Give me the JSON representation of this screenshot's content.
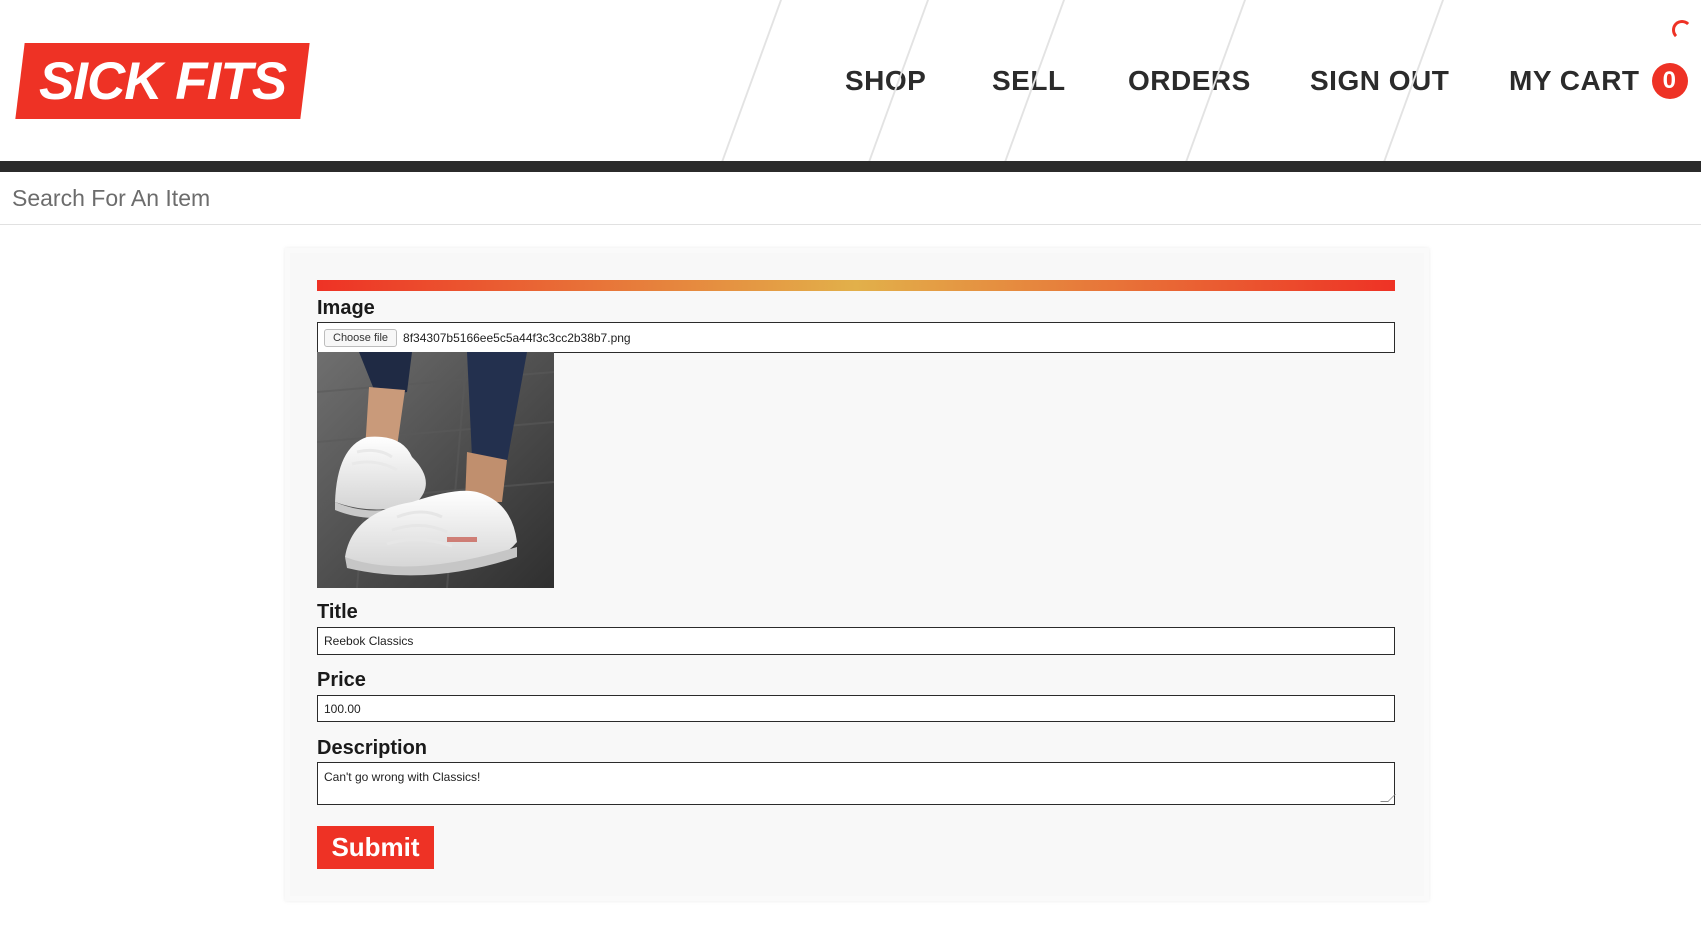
{
  "header": {
    "logo": "SICK FITS",
    "nav": {
      "shop": "SHOP",
      "sell": "SELL",
      "orders": "ORDERS",
      "signout": "SIGN OUT",
      "cart": "MY CART",
      "cart_count": "0"
    }
  },
  "search": {
    "placeholder": "Search For An Item"
  },
  "form": {
    "image_label": "Image",
    "file_button": "Choose file",
    "file_name": "8f34307b5166ee5c5a44f3c3cc2b38b7.png",
    "title_label": "Title",
    "title_value": "Reebok Classics",
    "price_label": "Price",
    "price_value": "100.00",
    "description_label": "Description",
    "description_value": "Can't go wrong with Classics!",
    "submit": "Submit"
  },
  "colors": {
    "brand_red": "#ee3225",
    "dark": "#2b2b2b",
    "gradient_mid": "#e2b04a"
  },
  "icons": [
    "spinner-icon",
    "resize-handle-icon"
  ]
}
